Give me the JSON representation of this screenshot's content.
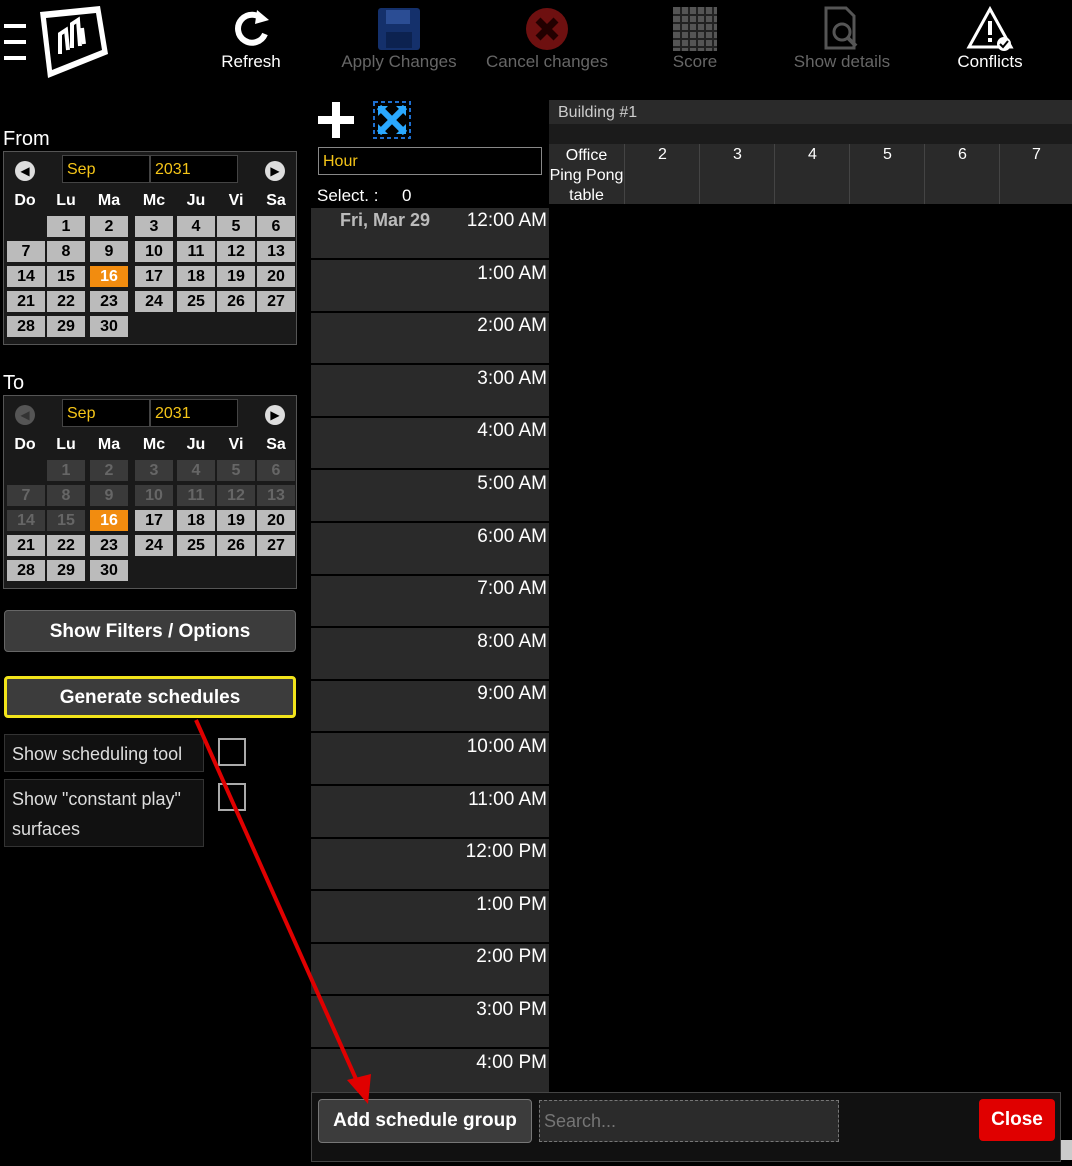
{
  "toolbar": {
    "refresh": "Refresh",
    "apply": "Apply Changes",
    "cancel": "Cancel changes",
    "score": "Score",
    "details": "Show details",
    "conflicts": "Conflicts"
  },
  "from_calendar": {
    "title": "From",
    "month": "Sep",
    "year": "2031",
    "weekdays": [
      "Do",
      "Lu",
      "Ma",
      "Mc",
      "Ju",
      "Vi",
      "Sa"
    ],
    "selected_day": "16"
  },
  "to_calendar": {
    "title": "To",
    "month": "Sep",
    "year": "2031",
    "weekdays": [
      "Do",
      "Lu",
      "Ma",
      "Mc",
      "Ju",
      "Vi",
      "Sa"
    ],
    "selected_day": "16"
  },
  "buttons": {
    "filters": "Show Filters / Options",
    "generate": "Generate schedules"
  },
  "options": {
    "scheduling_tool": "Show scheduling tool",
    "constant_play": "Show \"constant play\" surfaces"
  },
  "scheduler": {
    "granularity": "Hour",
    "select_label": "Select. :",
    "select_count": "0",
    "date": "Fri, Mar 29",
    "building": "Building #1",
    "resources": [
      "Office Ping Pong table",
      "2",
      "3",
      "4",
      "5",
      "6",
      "7"
    ],
    "times": [
      "12:00 AM",
      "1:00 AM",
      "2:00 AM",
      "3:00 AM",
      "4:00 AM",
      "5:00 AM",
      "6:00 AM",
      "7:00 AM",
      "8:00 AM",
      "9:00 AM",
      "10:00 AM",
      "11:00 AM",
      "12:00 PM",
      "1:00 PM",
      "2:00 PM",
      "3:00 PM",
      "4:00 PM"
    ]
  },
  "bottom": {
    "add_group": "Add schedule group",
    "search_placeholder": "Search...",
    "close": "Close"
  },
  "colors": {
    "accent_selected_day": "#f28c0f",
    "highlight_border": "#f2e41b",
    "close_button": "#e00000",
    "arrow": "#e00000"
  }
}
